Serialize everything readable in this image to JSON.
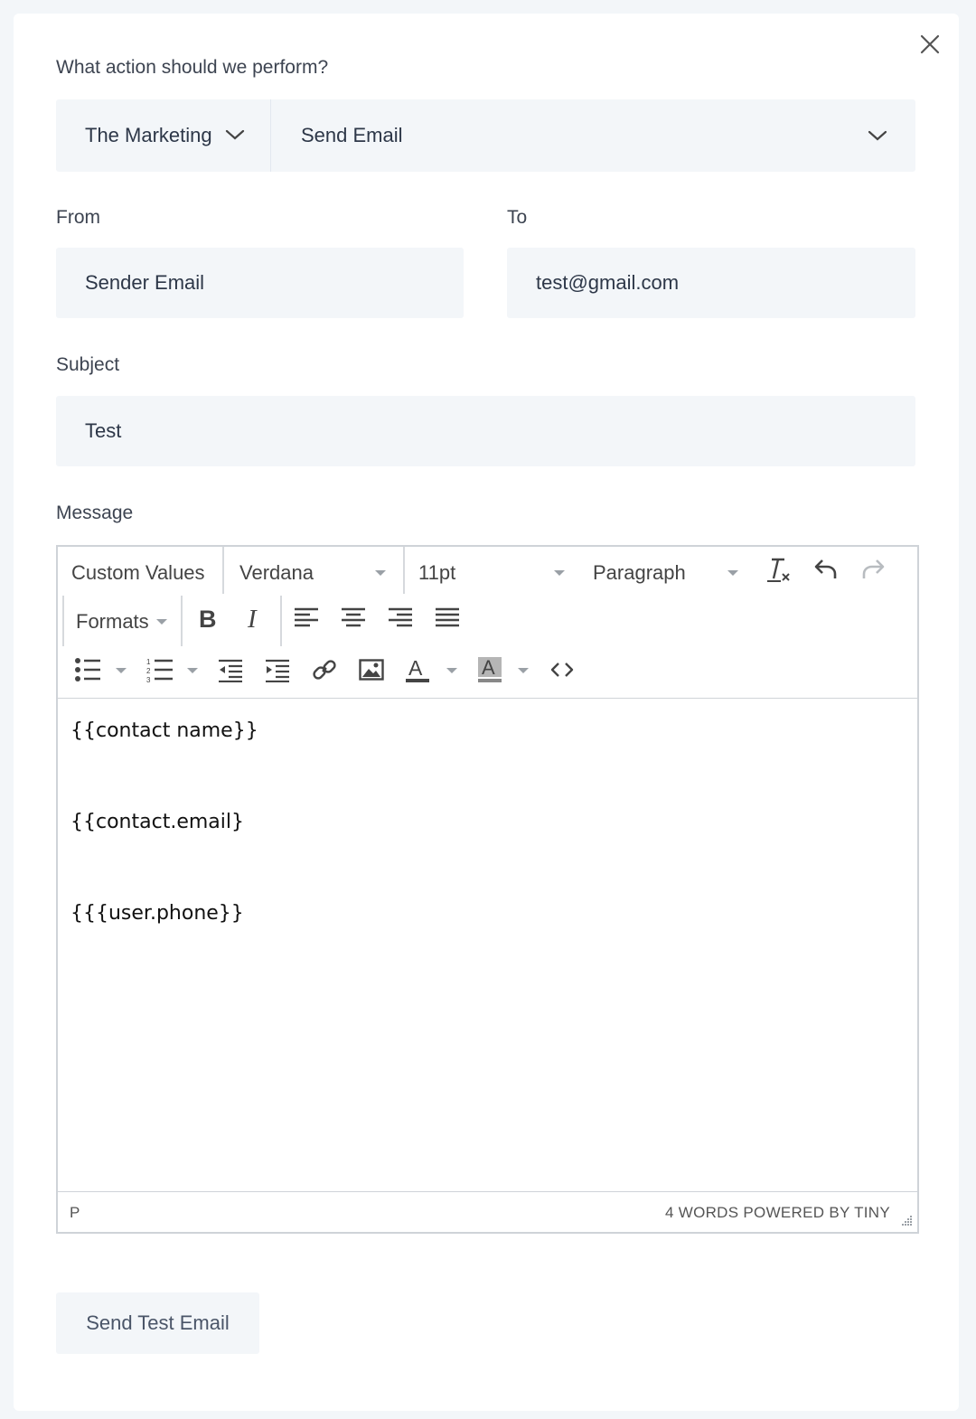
{
  "modal": {
    "action_label": "What action should we perform?",
    "app_select": "The Marketing",
    "action_select": "Send Email",
    "from_label": "From",
    "from_value": "Sender Email",
    "to_label": "To",
    "to_value": "test@gmail.com",
    "subject_label": "Subject",
    "subject_value": "Test",
    "message_label": "Message",
    "send_test_label": "Send Test Email"
  },
  "editor": {
    "custom_values": "Custom Values",
    "font_family": "Verdana",
    "font_size": "11pt",
    "block_format": "Paragraph",
    "formats": "Formats",
    "content_lines": [
      "{{contact name}}",
      "{{contact.email}",
      "{{{user.phone}}"
    ],
    "status_path": "P",
    "status_right": "4 WORDS POWERED BY TINY"
  },
  "icons": {
    "close": "close-icon",
    "chevron": "chevron-down-icon",
    "clear_format": "clear-formatting-icon",
    "undo": "undo-icon",
    "redo": "redo-icon",
    "bold": "bold-icon",
    "italic": "italic-icon",
    "align_left": "align-left-icon",
    "align_center": "align-center-icon",
    "align_right": "align-right-icon",
    "justify": "align-justify-icon",
    "bullet_list": "bullet-list-icon",
    "numbered_list": "numbered-list-icon",
    "outdent": "outdent-icon",
    "indent": "indent-icon",
    "link": "link-icon",
    "image": "image-icon",
    "text_color": "text-color-icon",
    "bg_color": "background-color-icon",
    "code": "source-code-icon"
  }
}
